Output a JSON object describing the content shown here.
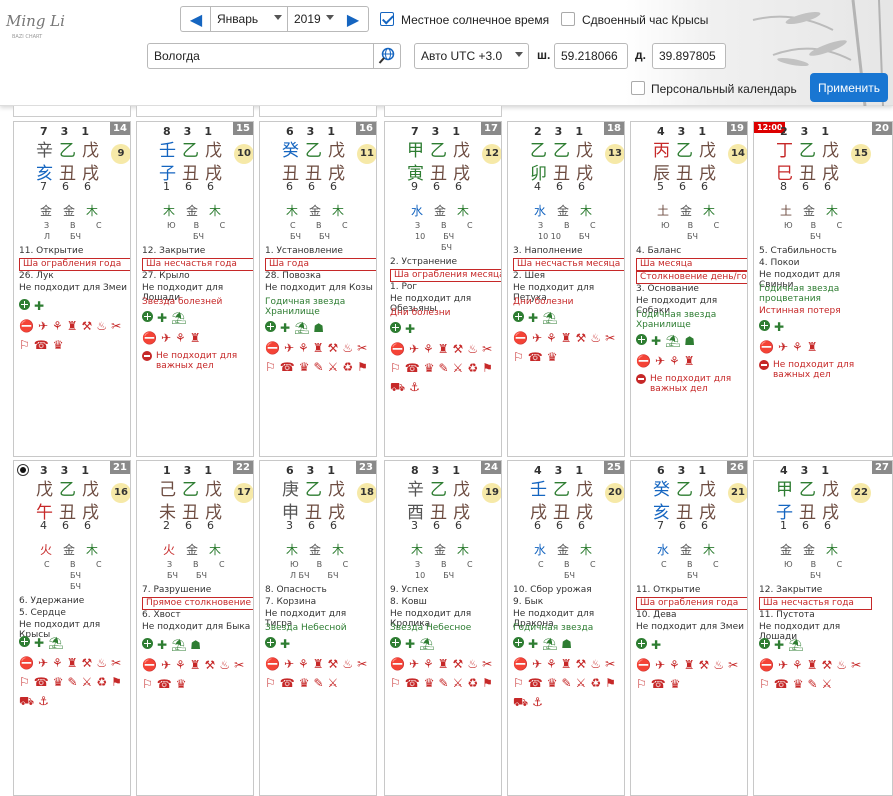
{
  "app": {
    "logo_text": "Ming Li",
    "logo_sub": "BAZI CHART"
  },
  "controls": {
    "month": "Январь",
    "year": "2019",
    "solar_time_label": "Местное солнечное время",
    "rat_hour_label": "Сдвоенный час Крысы",
    "city": "Вологда",
    "utc": "Авто UTC +3.0",
    "lat_label": "ш.",
    "lat": "59.218066",
    "lon_label": "д.",
    "lon": "39.897805",
    "personal_label": "Персональный календарь",
    "apply": "Применить"
  },
  "colors": {
    "fire": "#c62828",
    "wood": "#2e7d32",
    "water": "#1565c0",
    "earth": "#6d4c41",
    "metal": "#555555",
    "accent": "#1976d2"
  },
  "days": [
    {
      "day": "14",
      "top": [
        "7",
        "3",
        "1"
      ],
      "stems": [
        "辛",
        "乙",
        "戊"
      ],
      "branches": [
        "亥",
        "丑",
        "戌"
      ],
      "moon": "9",
      "bottom": [
        "7",
        "6",
        "6"
      ],
      "elems": [
        "金",
        "金",
        "木"
      ],
      "e1": [
        "З",
        "В",
        "С"
      ],
      "e2": [
        "Л",
        "БЧ",
        ""
      ],
      "e3": [],
      "officer": "11. Открытие",
      "sha": "Ша ограбления года",
      "mansion": "26. Лук",
      "not_for": "Не подходит для Змеи",
      "stars": [],
      "red": [],
      "warn": "",
      "has_radio": false,
      "hour": ""
    },
    {
      "day": "15",
      "top": [
        "8",
        "3",
        "1"
      ],
      "stems": [
        "壬",
        "乙",
        "戊"
      ],
      "branches": [
        "子",
        "丑",
        "戌"
      ],
      "moon": "10",
      "bottom": [
        "1",
        "6",
        "6"
      ],
      "elems": [
        "木",
        "金",
        "木"
      ],
      "e1": [
        "Ю",
        "В",
        "С"
      ],
      "e2": [
        "",
        "БЧ",
        ""
      ],
      "e3": [],
      "officer": "12. Закрытие",
      "sha": "Ша несчастья года",
      "mansion": "27. Крыло",
      "not_for": "Не подходит для Лошади",
      "stars": [],
      "red": [
        "Звезда болезней"
      ],
      "warn": "Не подходит для важных дел",
      "has_radio": false,
      "hour": ""
    },
    {
      "day": "16",
      "top": [
        "6",
        "3",
        "1"
      ],
      "stems": [
        "癸",
        "乙",
        "戊"
      ],
      "branches": [
        "丑",
        "丑",
        "戌"
      ],
      "moon": "11",
      "bottom": [
        "6",
        "6",
        "6"
      ],
      "elems": [
        "木",
        "金",
        "木"
      ],
      "e1": [
        "С",
        "В",
        "С"
      ],
      "e2": [
        "БЧ",
        "БЧ",
        ""
      ],
      "e3": [],
      "officer": "1. Установление",
      "sha": "Ша года",
      "mansion": "28. Повозка",
      "not_for": "Не подходит для Козы",
      "stars": [
        "Годичная звезда Хранилище"
      ],
      "red": [],
      "warn": "",
      "has_radio": false,
      "hour": ""
    },
    {
      "day": "17",
      "top": [
        "7",
        "3",
        "1"
      ],
      "stems": [
        "甲",
        "乙",
        "戊"
      ],
      "branches": [
        "寅",
        "丑",
        "戌"
      ],
      "moon": "12",
      "bottom": [
        "9",
        "6",
        "6"
      ],
      "elems": [
        "水",
        "金",
        "木"
      ],
      "e1": [
        "З",
        "В",
        "С"
      ],
      "e2": [
        "10",
        "БЧ",
        ""
      ],
      "e3": [
        "",
        "БЧ",
        ""
      ],
      "officer": "2. Устранение",
      "sha": "Ша ограбления месяца",
      "mansion": "1. Рог",
      "not_for": "Не подходит для Обезьяны",
      "stars": [],
      "red": [
        "Дни болезни"
      ],
      "warn": "",
      "has_radio": false,
      "hour": ""
    },
    {
      "day": "18",
      "top": [
        "2",
        "3",
        "1"
      ],
      "stems": [
        "乙",
        "乙",
        "戊"
      ],
      "branches": [
        "卯",
        "丑",
        "戌"
      ],
      "moon": "13",
      "bottom": [
        "4",
        "6",
        "6"
      ],
      "elems": [
        "水",
        "金",
        "木"
      ],
      "e1": [
        "З",
        "В",
        "С"
      ],
      "e2": [
        "10 10",
        "БЧ",
        ""
      ],
      "e3": [],
      "officer": "3. Наполнение",
      "sha": "Ша несчастья месяца",
      "mansion": "2. Шея",
      "not_for": "Не подходит для Петуха",
      "stars": [],
      "red": [
        "Дни болезни"
      ],
      "warn": "",
      "has_radio": false,
      "hour": ""
    },
    {
      "day": "19",
      "top": [
        "4",
        "3",
        "1"
      ],
      "stems": [
        "丙",
        "乙",
        "戊"
      ],
      "branches": [
        "辰",
        "丑",
        "戌"
      ],
      "moon": "14",
      "bottom": [
        "5",
        "6",
        "6"
      ],
      "elems": [
        "土",
        "金",
        "木"
      ],
      "e1": [
        "Ю",
        "В",
        "С"
      ],
      "e2": [
        "",
        "БЧ",
        ""
      ],
      "e3": [],
      "officer": "4. Баланс",
      "sha": "Ша месяца",
      "sha2": "Столкновение день/год",
      "mansion": "3. Основание",
      "not_for": "Не подходит для Собаки",
      "stars": [
        "Годичная звезда Хранилище"
      ],
      "red": [],
      "warn": "Не подходит для важных дел",
      "has_radio": false,
      "hour": ""
    },
    {
      "day": "20",
      "top": [
        "2",
        "3",
        "1"
      ],
      "stems": [
        "丁",
        "乙",
        "戊"
      ],
      "branches": [
        "巳",
        "丑",
        "戌"
      ],
      "moon": "15",
      "bottom": [
        "8",
        "6",
        "6"
      ],
      "elems": [
        "土",
        "金",
        "木"
      ],
      "e1": [
        "Ю",
        "В",
        "С"
      ],
      "e2": [
        "",
        "БЧ",
        ""
      ],
      "e3": [],
      "officer": "5. Стабильность",
      "sha": "",
      "mansion": "4. Покои",
      "not_for": "Не подходит для Свиньи",
      "stars": [
        "Годичная звезда процветания"
      ],
      "red": [
        "Истинная потеря"
      ],
      "warn": "Не подходит для важных дел",
      "has_radio": false,
      "hour": "12:00"
    },
    {
      "day": "21",
      "top": [
        "3",
        "3",
        "1"
      ],
      "stems": [
        "戊",
        "乙",
        "戊"
      ],
      "branches": [
        "午",
        "丑",
        "戌"
      ],
      "moon": "16",
      "bottom": [
        "4",
        "6",
        "6"
      ],
      "elems": [
        "火",
        "金",
        "木"
      ],
      "e1": [
        "С",
        "В",
        "С"
      ],
      "e2": [
        "",
        "БЧ",
        ""
      ],
      "e3": [
        "",
        "БЧ",
        ""
      ],
      "officer": "6. Удержание",
      "sha": "",
      "mansion": "5. Сердце",
      "not_for": "Не подходит для Крысы",
      "stars": [],
      "red": [],
      "warn": "",
      "has_radio": true,
      "hour": ""
    },
    {
      "day": "22",
      "top": [
        "1",
        "3",
        "1"
      ],
      "stems": [
        "己",
        "乙",
        "戊"
      ],
      "branches": [
        "未",
        "丑",
        "戌"
      ],
      "moon": "17",
      "bottom": [
        "2",
        "6",
        "6"
      ],
      "elems": [
        "火",
        "金",
        "木"
      ],
      "e1": [
        "З",
        "В",
        "С"
      ],
      "e2": [
        "БЧ",
        "БЧ",
        ""
      ],
      "e3": [],
      "officer": "7. Разрушение",
      "sha": "Прямое столкновение день/месяц",
      "mansion": "6. Хвост",
      "not_for": "Не подходит для Быка",
      "stars": [],
      "red": [],
      "warn": "",
      "has_radio": false,
      "hour": ""
    },
    {
      "day": "23",
      "top": [
        "6",
        "3",
        "1"
      ],
      "stems": [
        "庚",
        "乙",
        "戊"
      ],
      "branches": [
        "申",
        "丑",
        "戌"
      ],
      "moon": "18",
      "bottom": [
        "3",
        "6",
        "6"
      ],
      "elems": [
        "木",
        "金",
        "木"
      ],
      "e1": [
        "Ю",
        "В",
        "С"
      ],
      "e2": [
        "Л БЧ",
        "БЧ",
        ""
      ],
      "e3": [],
      "officer": "8. Опасность",
      "sha": "",
      "mansion": "7. Корзина",
      "not_for": "Не подходит для Тигра",
      "stars": [
        "Звезда Небесной"
      ],
      "red": [],
      "warn": "",
      "has_radio": false,
      "hour": ""
    },
    {
      "day": "24",
      "top": [
        "8",
        "3",
        "1"
      ],
      "stems": [
        "辛",
        "乙",
        "戊"
      ],
      "branches": [
        "酉",
        "丑",
        "戌"
      ],
      "moon": "19",
      "bottom": [
        "3",
        "6",
        "6"
      ],
      "elems": [
        "木",
        "金",
        "木"
      ],
      "e1": [
        "З",
        "В",
        "С"
      ],
      "e2": [
        "10",
        "БЧ",
        ""
      ],
      "e3": [],
      "officer": "9. Успех",
      "sha": "",
      "mansion": "8. Ковш",
      "not_for": "Не подходит для Кролика",
      "stars": [
        "Звезда Небесное"
      ],
      "red": [],
      "warn": "",
      "has_radio": false,
      "hour": ""
    },
    {
      "day": "25",
      "top": [
        "4",
        "3",
        "1"
      ],
      "stems": [
        "壬",
        "乙",
        "戊"
      ],
      "branches": [
        "戌",
        "丑",
        "戌"
      ],
      "moon": "20",
      "bottom": [
        "6",
        "6",
        "6"
      ],
      "elems": [
        "水",
        "金",
        "木"
      ],
      "e1": [
        "С",
        "В",
        "С"
      ],
      "e2": [
        "",
        "БЧ",
        ""
      ],
      "e3": [],
      "officer": "10. Сбор урожая",
      "sha": "",
      "mansion": "9. Бык",
      "not_for": "Не подходит для Дракона",
      "stars": [
        "Годичная звезда"
      ],
      "red": [],
      "warn": "",
      "has_radio": false,
      "hour": ""
    },
    {
      "day": "26",
      "top": [
        "6",
        "3",
        "1"
      ],
      "stems": [
        "癸",
        "乙",
        "戊"
      ],
      "branches": [
        "亥",
        "丑",
        "戌"
      ],
      "moon": "21",
      "bottom": [
        "7",
        "6",
        "6"
      ],
      "elems": [
        "水",
        "金",
        "木"
      ],
      "e1": [
        "С",
        "В",
        "С"
      ],
      "e2": [
        "",
        "БЧ",
        ""
      ],
      "e3": [],
      "officer": "11. Открытие",
      "sha": "Ша ограбления года",
      "mansion": "10. Дева",
      "not_for": "Не подходит для Змеи",
      "stars": [],
      "red": [],
      "warn": "",
      "has_radio": false,
      "hour": ""
    },
    {
      "day": "27",
      "top": [
        "4",
        "3",
        "1"
      ],
      "stems": [
        "甲",
        "乙",
        "戊"
      ],
      "branches": [
        "子",
        "丑",
        "戌"
      ],
      "moon": "22",
      "bottom": [
        "1",
        "6",
        "6"
      ],
      "elems": [
        "金",
        "金",
        "木"
      ],
      "e1": [
        "Ю",
        "В",
        "С"
      ],
      "e2": [
        "",
        "БЧ",
        ""
      ],
      "e3": [],
      "officer": "12. Закрытие",
      "sha": "Ша несчастья года",
      "mansion": "11. Пустота",
      "not_for": "Не подходит для Лошади",
      "stars": [],
      "red": [],
      "warn": "",
      "has_radio": false,
      "hour": ""
    }
  ]
}
